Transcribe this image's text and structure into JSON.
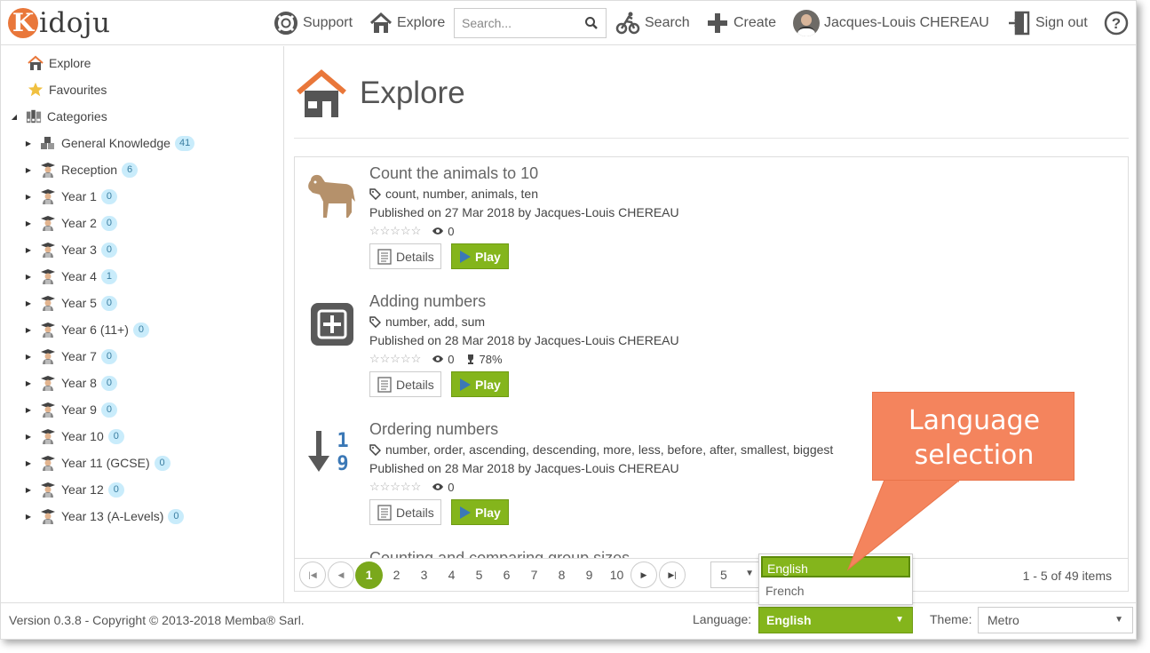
{
  "app": {
    "logo_k": "K",
    "logo_rest": "idoju"
  },
  "header": {
    "support": "Support",
    "explore": "Explore",
    "search_placeholder": "Search...",
    "search": "Search",
    "create": "Create",
    "user": "Jacques-Louis CHEREAU",
    "sign_out": "Sign out"
  },
  "sidebar": {
    "explore": "Explore",
    "favourites": "Favourites",
    "categories": "Categories",
    "items": [
      {
        "label": "General Knowledge",
        "count": "41"
      },
      {
        "label": "Reception",
        "count": "6"
      },
      {
        "label": "Year 1",
        "count": "0"
      },
      {
        "label": "Year 2",
        "count": "0"
      },
      {
        "label": "Year 3",
        "count": "0"
      },
      {
        "label": "Year 4",
        "count": "1"
      },
      {
        "label": "Year 5",
        "count": "0"
      },
      {
        "label": "Year 6 (11+)",
        "count": "0"
      },
      {
        "label": "Year 7",
        "count": "0"
      },
      {
        "label": "Year 8",
        "count": "0"
      },
      {
        "label": "Year 9",
        "count": "0"
      },
      {
        "label": "Year 10",
        "count": "0"
      },
      {
        "label": "Year 11 (GCSE)",
        "count": "0"
      },
      {
        "label": "Year 12",
        "count": "0"
      },
      {
        "label": "Year 13 (A-Levels)",
        "count": "0"
      }
    ]
  },
  "main": {
    "title": "Explore",
    "items": [
      {
        "title": "Count the animals to 10",
        "tags": "count, number, animals, ten",
        "published": "Published on 27 Mar 2018 by Jacques-Louis CHEREAU",
        "stars": "☆☆☆☆☆",
        "views": "0",
        "score": ""
      },
      {
        "title": "Adding numbers",
        "tags": "number, add, sum",
        "published": "Published on 28 Mar 2018 by Jacques-Louis CHEREAU",
        "stars": "☆☆☆☆☆",
        "views": "0",
        "score": "78%"
      },
      {
        "title": "Ordering numbers",
        "tags": "number, order, ascending, descending, more, less, before, after, smallest, biggest",
        "published": "Published on 28 Mar 2018 by Jacques-Louis CHEREAU",
        "stars": "☆☆☆☆☆",
        "views": "0",
        "score": ""
      }
    ],
    "peek_title": "Counting and comparing group sizes",
    "details_label": "Details",
    "play_label": "Play",
    "thumb_ordering_top": "1",
    "thumb_ordering_bottom": "9"
  },
  "pager": {
    "pages": [
      "1",
      "2",
      "3",
      "4",
      "5",
      "6",
      "7",
      "8",
      "9",
      "10"
    ],
    "current": "1",
    "page_size": "5",
    "info": "1 - 5 of 49 items"
  },
  "footer": {
    "version": "Version 0.3.8 - Copyright © 2013-2018 Memba® Sarl.",
    "language_label": "Language:",
    "language_value": "English",
    "theme_label": "Theme:",
    "theme_value": "Metro"
  },
  "language_popup": {
    "options": [
      "English",
      "French"
    ],
    "selected": "English"
  },
  "callout": {
    "line1": "Language",
    "line2": "selection"
  },
  "colors": {
    "accent_green": "#84b51c",
    "logo_orange": "#e9773a",
    "callout": "#f4845d",
    "badge": "#c9ecfb"
  }
}
